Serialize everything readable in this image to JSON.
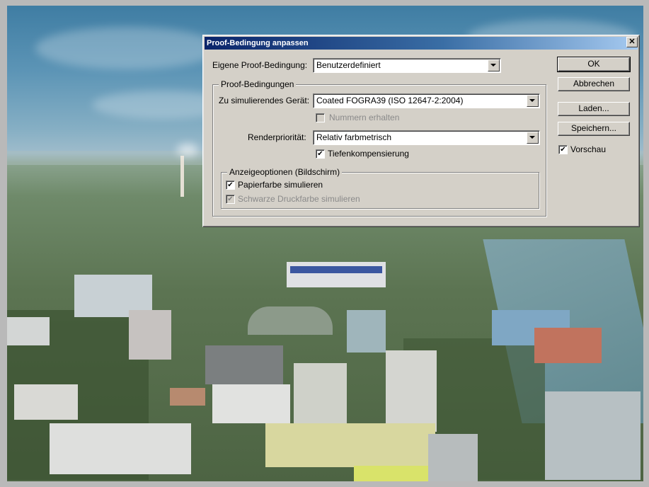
{
  "dialog": {
    "title": "Proof-Bedingung anpassen",
    "close_glyph": "✕",
    "custom_label": "Eigene Proof-Bedingung:",
    "custom_value": "Benutzerdefiniert",
    "proof_group": {
      "legend": "Proof-Bedingungen",
      "device_label": "Zu simulierendes Gerät:",
      "device_value": "Coated FOGRA39 (ISO 12647-2:2004)",
      "preserve_numbers_label": "Nummern erhalten",
      "preserve_numbers_checked": false,
      "intent_label": "Renderpriorität:",
      "intent_value": "Relativ farbmetrisch",
      "bpc_label": "Tiefenkompensierung",
      "bpc_checked": true
    },
    "display_group": {
      "legend": "Anzeigeoptionen (Bildschirm)",
      "paper_label": "Papierfarbe simulieren",
      "paper_checked": true,
      "black_ink_label": "Schwarze Druckfarbe simulieren",
      "black_ink_checked": true
    },
    "buttons": {
      "ok": "OK",
      "cancel": "Abbrechen",
      "load": "Laden...",
      "save": "Speichern..."
    },
    "preview_label": "Vorschau",
    "preview_checked": true,
    "check_glyph": "✔"
  }
}
